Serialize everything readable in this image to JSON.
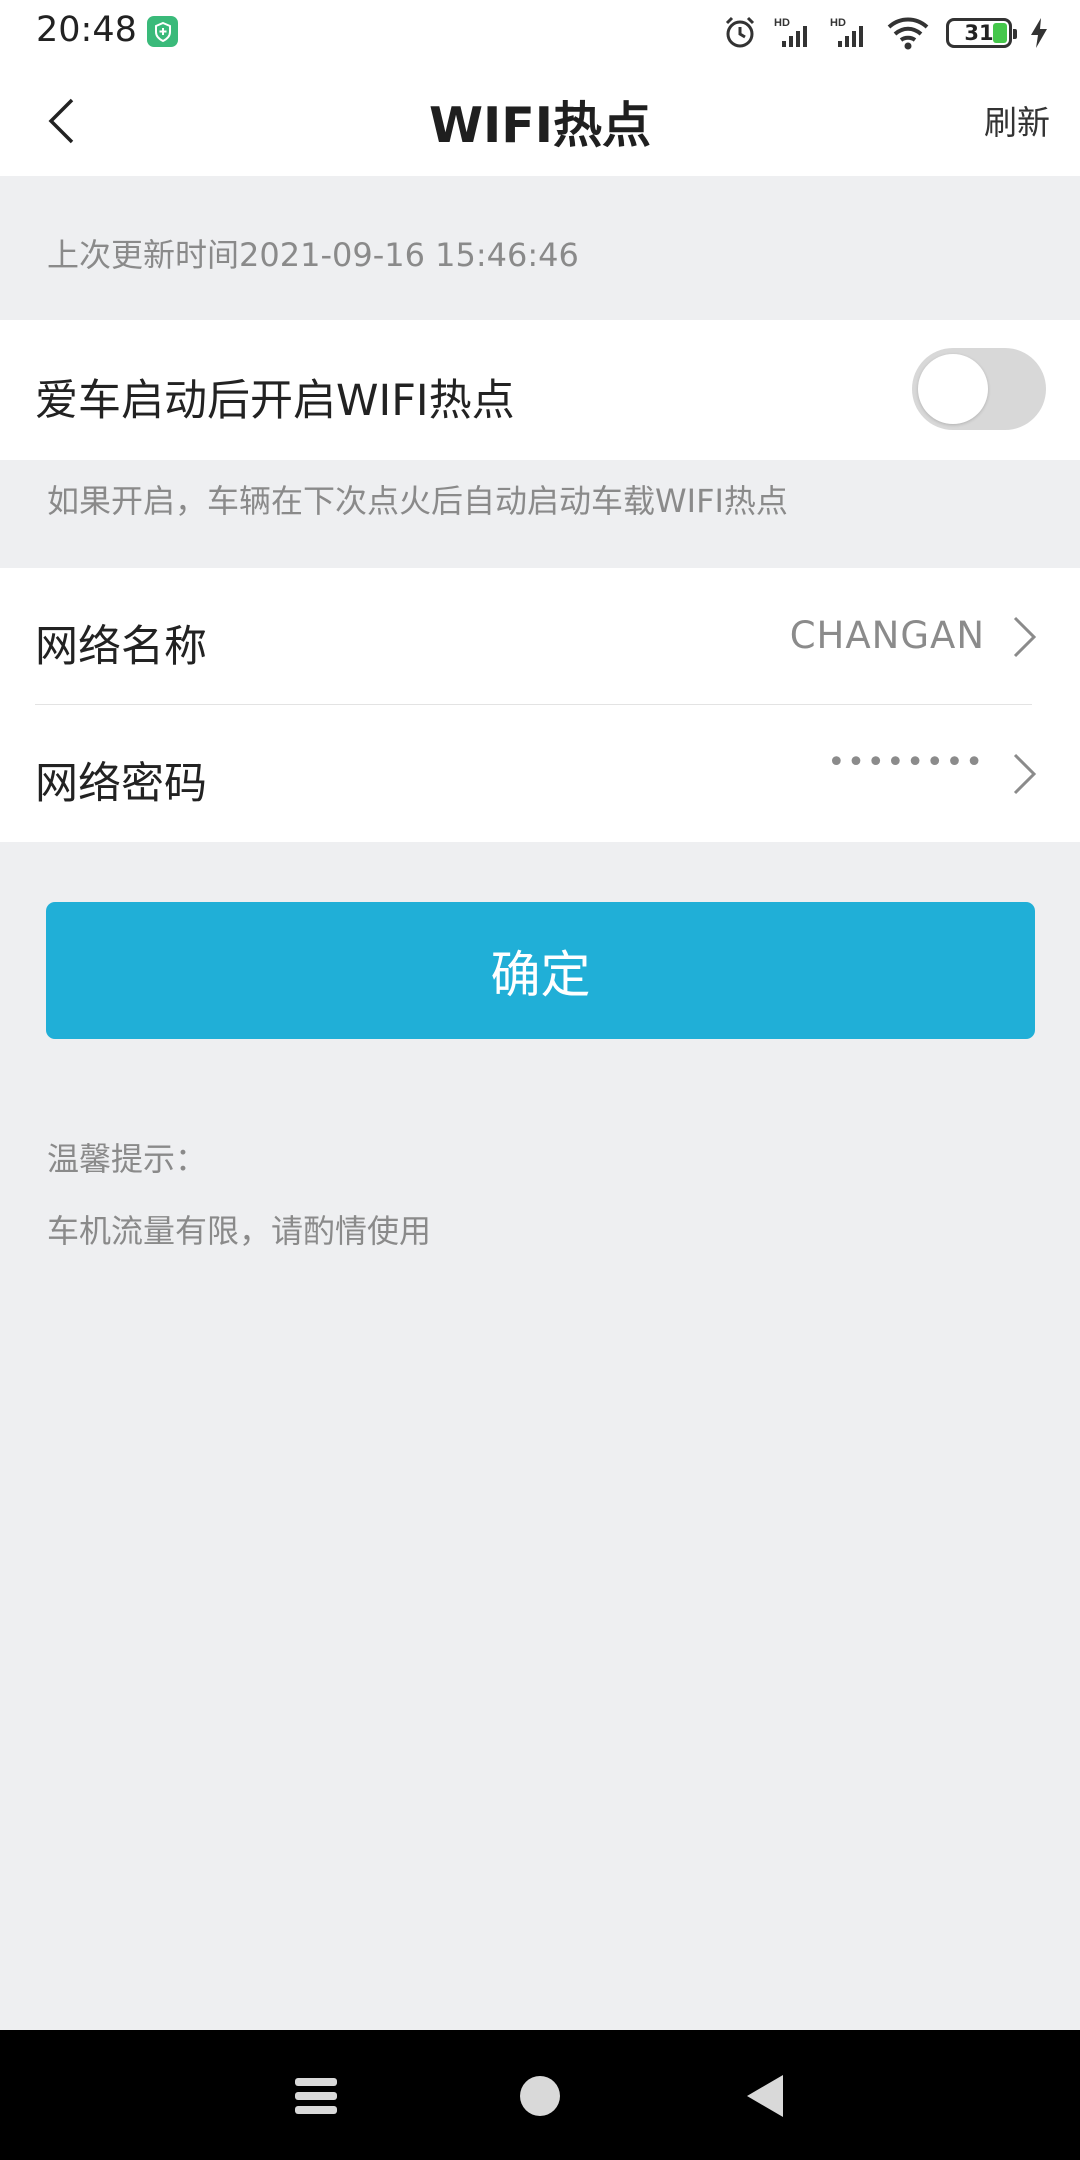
{
  "status_bar": {
    "time": "20:48",
    "battery_level": "31",
    "icons": [
      "shield-icon",
      "alarm-icon",
      "hd-signal-icon",
      "hd-signal-icon",
      "wifi-icon",
      "battery-icon",
      "charging-icon"
    ]
  },
  "header": {
    "title": "WIFI热点",
    "refresh_label": "刷新"
  },
  "last_update": "上次更新时间2021-09-16 15:46:46",
  "auto_hotspot": {
    "label": "爱车启动后开启WIFI热点",
    "enabled": false,
    "hint": "如果开启，车辆在下次点火后自动启动车载WIFI热点"
  },
  "network": {
    "name_label": "网络名称",
    "name_value": "CHANGAN",
    "password_label": "网络密码",
    "password_value": "••••••••"
  },
  "confirm_label": "确定",
  "tips": {
    "title": "温馨提示：",
    "text": "车机流量有限，请酌情使用"
  },
  "colors": {
    "accent": "#20afd7",
    "background": "#eeeff1",
    "secondary_text": "#8a8a8a"
  }
}
